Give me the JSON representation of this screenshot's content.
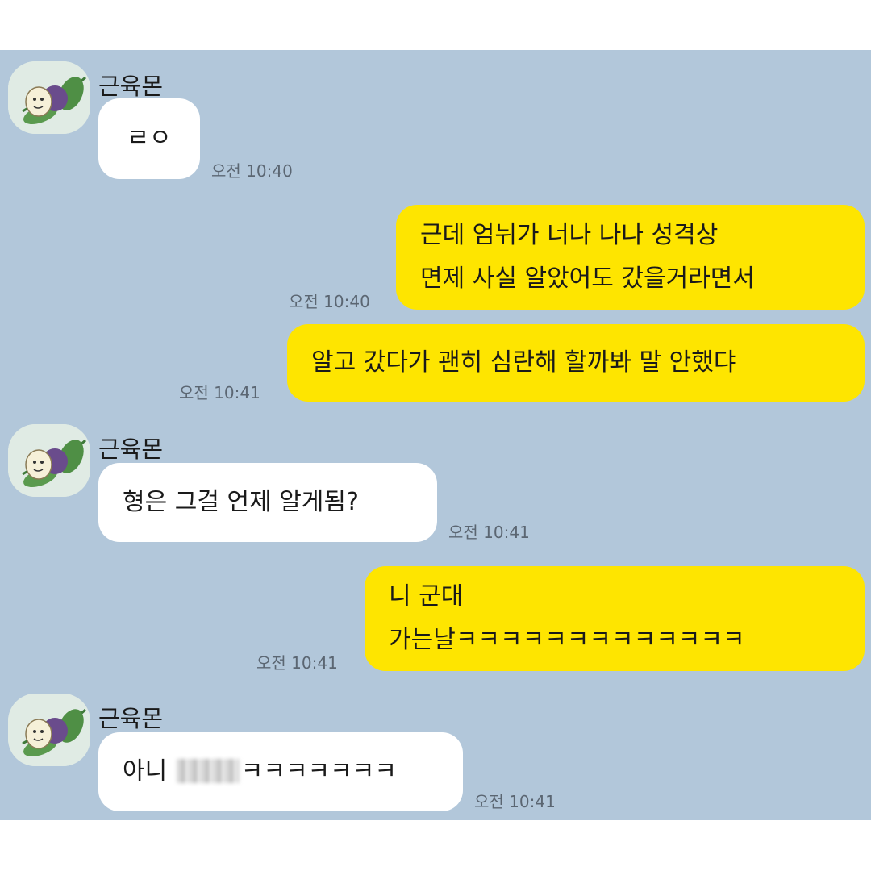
{
  "messages": [
    {
      "type": "in",
      "sender": "근육몬",
      "lines": [
        "ㄹㅇ"
      ],
      "time": "오전 10:40"
    },
    {
      "type": "out",
      "lines": [
        "근데 엄뉘가 너나 나나 성격상",
        "면제 사실 알았어도 갔을거라면서"
      ],
      "time": "오전 10:40"
    },
    {
      "type": "out",
      "lines": [
        "알고 갔다가 괜히 심란해 할까봐 말 안했댜"
      ],
      "time": "오전 10:41"
    },
    {
      "type": "in",
      "sender": "근육몬",
      "lines": [
        "형은 그걸 언제 알게됨?"
      ],
      "time": "오전 10:41"
    },
    {
      "type": "out",
      "lines": [
        "니 군대",
        "가는날ㅋㅋㅋㅋㅋㅋㅋㅋㅋㅋㅋㅋㅋ"
      ],
      "time": "오전 10:41"
    },
    {
      "type": "in",
      "sender": "근육몬",
      "lines": [
        "아니",
        "ㅋㅋㅋㅋㅋㅋㅋ"
      ],
      "time": "오전 10:41"
    }
  ],
  "colors": {
    "chat_bg": "#b2c7da",
    "incoming_bubble": "#ffffff",
    "outgoing_bubble": "#fee500"
  },
  "icons": {
    "avatar": "snail-on-leaf-avatar-icon",
    "redaction": "blurred-text"
  }
}
